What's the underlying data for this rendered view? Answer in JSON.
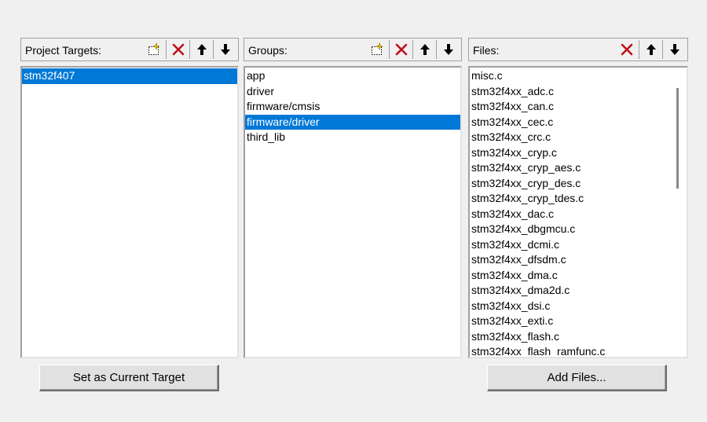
{
  "targets": {
    "header_label": "Project Targets:",
    "items": [
      "stm32f407"
    ],
    "selected_index": 0
  },
  "groups": {
    "header_label": "Groups:",
    "items": [
      "app",
      "driver",
      "firmware/cmsis",
      "firmware/driver",
      "third_lib"
    ],
    "selected_index": 3
  },
  "files": {
    "header_label": "Files:",
    "items": [
      "misc.c",
      "stm32f4xx_adc.c",
      "stm32f4xx_can.c",
      "stm32f4xx_cec.c",
      "stm32f4xx_crc.c",
      "stm32f4xx_cryp.c",
      "stm32f4xx_cryp_aes.c",
      "stm32f4xx_cryp_des.c",
      "stm32f4xx_cryp_tdes.c",
      "stm32f4xx_dac.c",
      "stm32f4xx_dbgmcu.c",
      "stm32f4xx_dcmi.c",
      "stm32f4xx_dfsdm.c",
      "stm32f4xx_dma.c",
      "stm32f4xx_dma2d.c",
      "stm32f4xx_dsi.c",
      "stm32f4xx_exti.c",
      "stm32f4xx_flash.c",
      "stm32f4xx_flash_ramfunc.c"
    ],
    "selected_index": -1
  },
  "buttons": {
    "set_current_target": "Set as Current Target",
    "add_files": "Add Files..."
  },
  "icons": {
    "new": "new-item-icon",
    "delete": "delete-icon",
    "move_up": "move-up-icon",
    "move_down": "move-down-icon"
  },
  "colors": {
    "selection": "#0078d7",
    "delete": "#c0101a"
  }
}
